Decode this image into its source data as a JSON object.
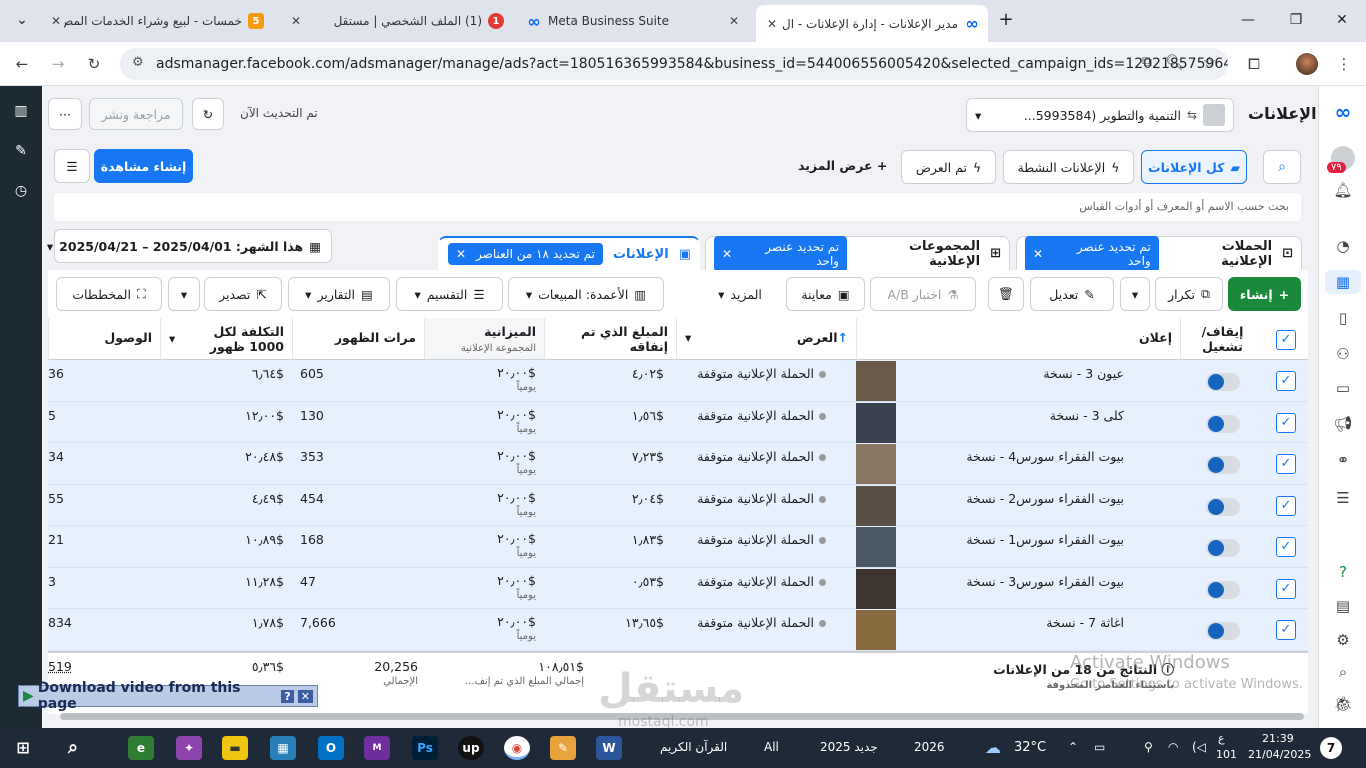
{
  "browser": {
    "tabs": [
      {
        "title": "خمسات - لبيع وشراء الخدمات المص",
        "favicon": "5",
        "favicon_color": "#f39c12"
      },
      {
        "title": "(1) الملف الشخصي | مستقل",
        "favicon": "1",
        "favicon_color": "#e53935"
      },
      {
        "title": "Meta Business Suite",
        "favicon": "∞",
        "favicon_color": "#0866ff"
      },
      {
        "title": "مدير الإعلانات - إدارة الإعلانات - ال",
        "favicon": "∞",
        "favicon_color": "#0866ff"
      }
    ],
    "new_tab": "+",
    "url": "adsmanager.facebook.com/adsmanager/manage/ads?act=180516365993584&business_id=544006556005420&selected_campaign_ids=12021857596497..."
  },
  "header": {
    "title": "الإعلانات",
    "account": "التنمية والتطوير (5993584...",
    "updated": "تم التحديث الآن",
    "review_publish": "مراجعة ونشر",
    "more": "···"
  },
  "toolbar": {
    "create_view": "إنشاء مشاهدة",
    "all_ads": "كل الإعلانات",
    "active_ads": "الإعلانات النشطة",
    "delivered": "تم العرض",
    "view_more": "عرض المزيد",
    "search_placeholder": "بحث حسب الاسم أو المعرف أو أدوات القياس",
    "date_range": "هذا الشهر: 2025/04/01 – 2025/04/21"
  },
  "level_tabs": [
    {
      "label": "الحملات الإعلانية",
      "chip": "تم تحديد عنصر واحد"
    },
    {
      "label": "المجموعات الإعلانية",
      "chip": "تم تحديد عنصر واحد"
    },
    {
      "label": "الإعلانات",
      "chip": "تم تحديد ١٨ من العناصر"
    }
  ],
  "actions": {
    "create": "إنشاء",
    "duplicate": "تكرار",
    "edit": "تعديل",
    "ab_test": "اختبار A/B",
    "preview": "معاينة",
    "more": "المزيد",
    "columns": "الأعمدة: المبيعات",
    "breakdown": "التقسيم",
    "reports": "التقارير",
    "export": "تصدير",
    "charts": "المخططات"
  },
  "table": {
    "headers": {
      "toggle": "إيقاف/ تشغيل",
      "ad": "إعلان",
      "delivery": "العرض",
      "spent": "المبلغ الذي تم إنفاقه",
      "budget": "الميزانية",
      "budget_sub": "المجموعة الإعلانية",
      "impressions": "مرات الظهور",
      "cpm": "التكلفة لكل 1000 ظهور",
      "reach": "الوصول"
    },
    "rows": [
      {
        "name": "عيون 3 - نسخة",
        "delivery": "الحملة الإعلانية متوقفة",
        "spent": "$٤٫٠٢",
        "budget": "$٢٠٫٠٠",
        "budget_period": "يومياً",
        "impressions": "605",
        "cpm": "$٦٫٦٤",
        "reach": "36",
        "thumb_color": "#6b5a48"
      },
      {
        "name": "كلى 3 - نسخة",
        "delivery": "الحملة الإعلانية متوقفة",
        "spent": "$١٫٥٦",
        "budget": "$٢٠٫٠٠",
        "budget_period": "يومياً",
        "impressions": "130",
        "cpm": "$١٢٫٠٠",
        "reach": "5",
        "thumb_color": "#3a4250"
      },
      {
        "name": "بيوت الفقراء سورس4 - نسخة",
        "delivery": "الحملة الإعلانية متوقفة",
        "spent": "$٧٫٢٣",
        "budget": "$٢٠٫٠٠",
        "budget_period": "يومياً",
        "impressions": "353",
        "cpm": "$٢٠٫٤٨",
        "reach": "34",
        "thumb_color": "#8a7560"
      },
      {
        "name": "بيوت الفقراء سورس2 - نسخة",
        "delivery": "الحملة الإعلانية متوقفة",
        "spent": "$٢٫٠٤",
        "budget": "$٢٠٫٠٠",
        "budget_period": "يومياً",
        "impressions": "454",
        "cpm": "$٤٫٤٩",
        "reach": "55",
        "thumb_color": "#5a5048"
      },
      {
        "name": "بيوت الفقراء سورس1 - نسخة",
        "delivery": "الحملة الإعلانية متوقفة",
        "spent": "$١٫٨٣",
        "budget": "$٢٠٫٠٠",
        "budget_period": "يومياً",
        "impressions": "168",
        "cpm": "$١٠٫٨٩",
        "reach": "21",
        "thumb_color": "#4a5866"
      },
      {
        "name": "بيوت الفقراء سورس3 - نسخة",
        "delivery": "الحملة الإعلانية متوقفة",
        "spent": "$٠٫٥٣",
        "budget": "$٢٠٫٠٠",
        "budget_period": "يومياً",
        "impressions": "47",
        "cpm": "$١١٫٢٨",
        "reach": "3",
        "thumb_color": "#3e3530"
      },
      {
        "name": "اغاثة 7 - نسخة",
        "delivery": "الحملة الإعلانية متوقفة",
        "spent": "$١٣٫٦٥",
        "budget": "$٢٠٫٠٠",
        "budget_period": "يومياً",
        "impressions": "7,666",
        "cpm": "$١٫٧٨",
        "reach": "834",
        "thumb_color": "#8a6a40"
      }
    ],
    "footer": {
      "label": "النتائج من 18 من الإعلانات",
      "sub": "باستثناء العناصر المحذوفة",
      "spent": "$١٠٨٫٥١",
      "spent_sub": "إجمالي المبلغ الذي تم إنف...",
      "impressions": "20,256",
      "impressions_sub": "الإجمالي",
      "cpm": "$٥٫٣٦",
      "reach": "519"
    }
  },
  "overlays": {
    "activate_title": "Activate Windows",
    "activate_sub": "Go to Settings to activate Windows.",
    "download_bar": "Download video from this page",
    "watermark": "مستقل",
    "watermark_sub": "mostaql.com"
  },
  "taskbar": {
    "quran": "القرآن الكريم",
    "all": "All",
    "new2025": "جديد 2025",
    "year": "2026",
    "temp": "32°C",
    "time": "21:39",
    "date": "21/04/2025",
    "lang": "ع",
    "notif": "101",
    "badge": "7"
  },
  "notifications": {
    "count": "٧٩"
  }
}
